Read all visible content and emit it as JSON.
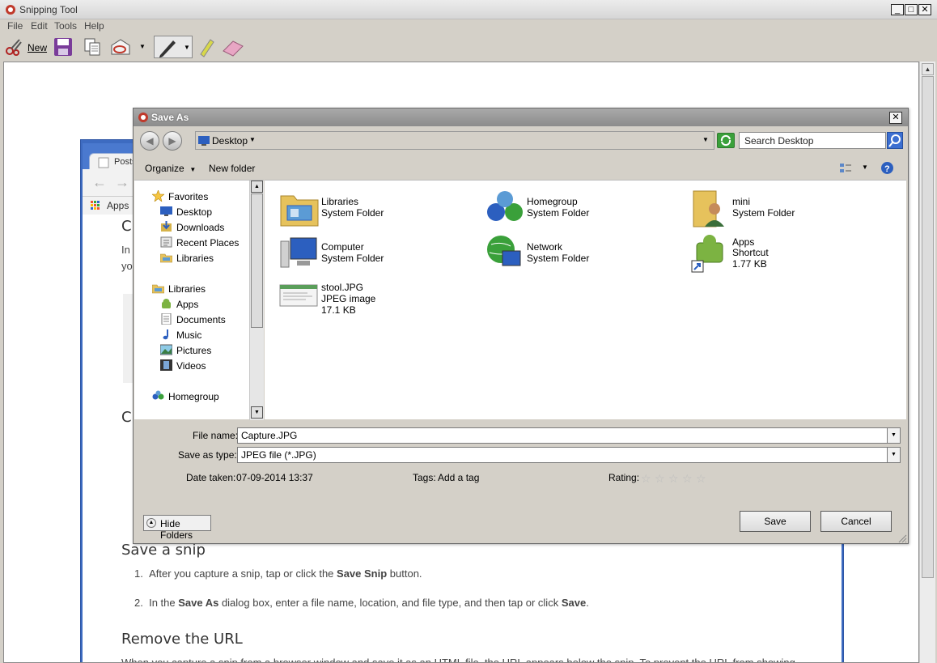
{
  "app": {
    "title": "Snipping Tool",
    "menu": [
      "File",
      "Edit",
      "Tools",
      "Help"
    ],
    "toolbar": {
      "new_label": "New"
    },
    "window_controls": {
      "minimize": "_",
      "maximize": "□",
      "close": "✕"
    }
  },
  "background_doc": {
    "tab_label": "Posts",
    "apps_label": "Apps",
    "fragment_c1": "C",
    "fragment_in": "In",
    "fragment_yo": "yo",
    "fragment_c2": "C",
    "heading_save_snip": "Save a snip",
    "step1_pre": "After you capture a snip, tap or click the ",
    "step1_bold": "Save Snip",
    "step1_post": " button.",
    "step2_pre": "In the ",
    "step2_bold1": "Save As",
    "step2_mid": " dialog box, enter a file name, location, and file type, and then tap or click ",
    "step2_bold2": "Save",
    "step2_post": ".",
    "heading_remove_url": "Remove the URL",
    "para_url": "When you capture a snip from a browser window and save it as an HTML file, the URL appears below the snip. To prevent the URL from showing"
  },
  "dialog": {
    "title": "Save As",
    "close": "✕",
    "address": "Desktop",
    "search_placeholder": "Search Desktop",
    "organize_label": "Organize",
    "new_folder_label": "New folder",
    "nav": {
      "favorites": "Favorites",
      "desktop": "Desktop",
      "downloads": "Downloads",
      "recent": "Recent Places",
      "libraries_fav": "Libraries",
      "libraries": "Libraries",
      "apps": "Apps",
      "documents": "Documents",
      "music": "Music",
      "pictures": "Pictures",
      "videos": "Videos",
      "homegroup": "Homegroup"
    },
    "files": [
      {
        "name": "Libraries",
        "type": "System Folder",
        "size": ""
      },
      {
        "name": "Homegroup",
        "type": "System Folder",
        "size": ""
      },
      {
        "name": "mini",
        "type": "System Folder",
        "size": ""
      },
      {
        "name": "Computer",
        "type": "System Folder",
        "size": ""
      },
      {
        "name": "Network",
        "type": "System Folder",
        "size": ""
      },
      {
        "name": "Apps",
        "type": "Shortcut",
        "size": "1.77 KB"
      },
      {
        "name": "stool.JPG",
        "type": "JPEG image",
        "size": "17.1 KB"
      }
    ],
    "file_name_label": "File name:",
    "file_name_value": "Capture.JPG",
    "save_type_label": "Save as type:",
    "save_type_value": "JPEG file (*.JPG)",
    "date_taken_label": "Date taken:",
    "date_taken_value": "07-09-2014 13:37",
    "tags_label": "Tags:",
    "tags_value": "Add a tag",
    "rating_label": "Rating:",
    "rating_value": 0,
    "hide_folders_label": "Hide Folders",
    "save_label": "Save",
    "cancel_label": "Cancel"
  }
}
